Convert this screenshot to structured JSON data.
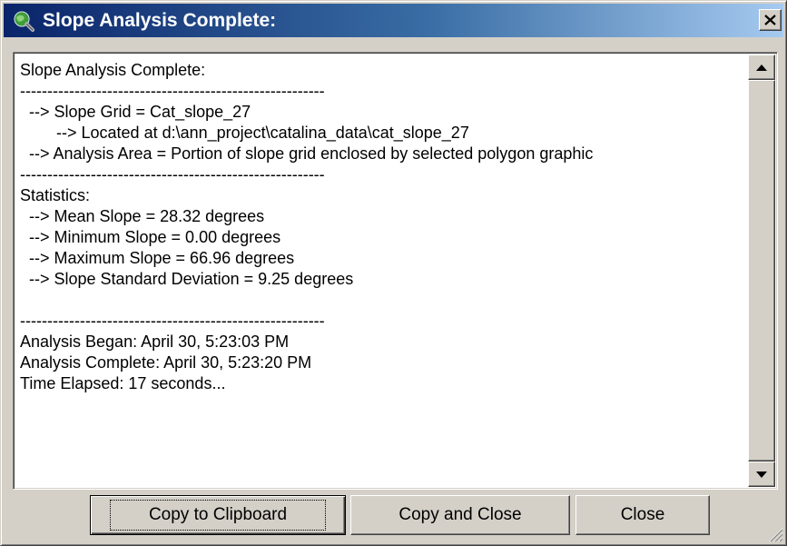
{
  "window": {
    "title": "Slope Analysis Complete:",
    "close_glyph": "✕"
  },
  "report": {
    "lines": [
      "Slope Analysis Complete:",
      "--------------------------------------------------------",
      "  --> Slope Grid = Cat_slope_27",
      "        --> Located at d:\\ann_project\\catalina_data\\cat_slope_27",
      "  --> Analysis Area = Portion of slope grid enclosed by selected polygon graphic",
      "--------------------------------------------------------",
      "Statistics:",
      "  --> Mean Slope = 28.32 degrees",
      "  --> Minimum Slope = 0.00 degrees",
      "  --> Maximum Slope = 66.96 degrees",
      "  --> Slope Standard Deviation = 9.25 degrees",
      "",
      "--------------------------------------------------------",
      "Analysis Began: April 30, 5:23:03 PM",
      "Analysis Complete: April 30, 5:23:20 PM",
      "Time Elapsed: 17 seconds..."
    ]
  },
  "buttons": {
    "copy_clipboard": "Copy to Clipboard",
    "copy_close": "Copy and Close",
    "close": "Close"
  },
  "icons": {
    "app": "globe-magnifier-icon",
    "close": "close-icon",
    "scroll_up": "arrow-up-icon",
    "scroll_down": "arrow-down-icon",
    "grip": "resize-grip-icon"
  },
  "colors": {
    "titlebar_start": "#0a246a",
    "titlebar_end": "#a6caf0",
    "face": "#d4d0c8"
  }
}
